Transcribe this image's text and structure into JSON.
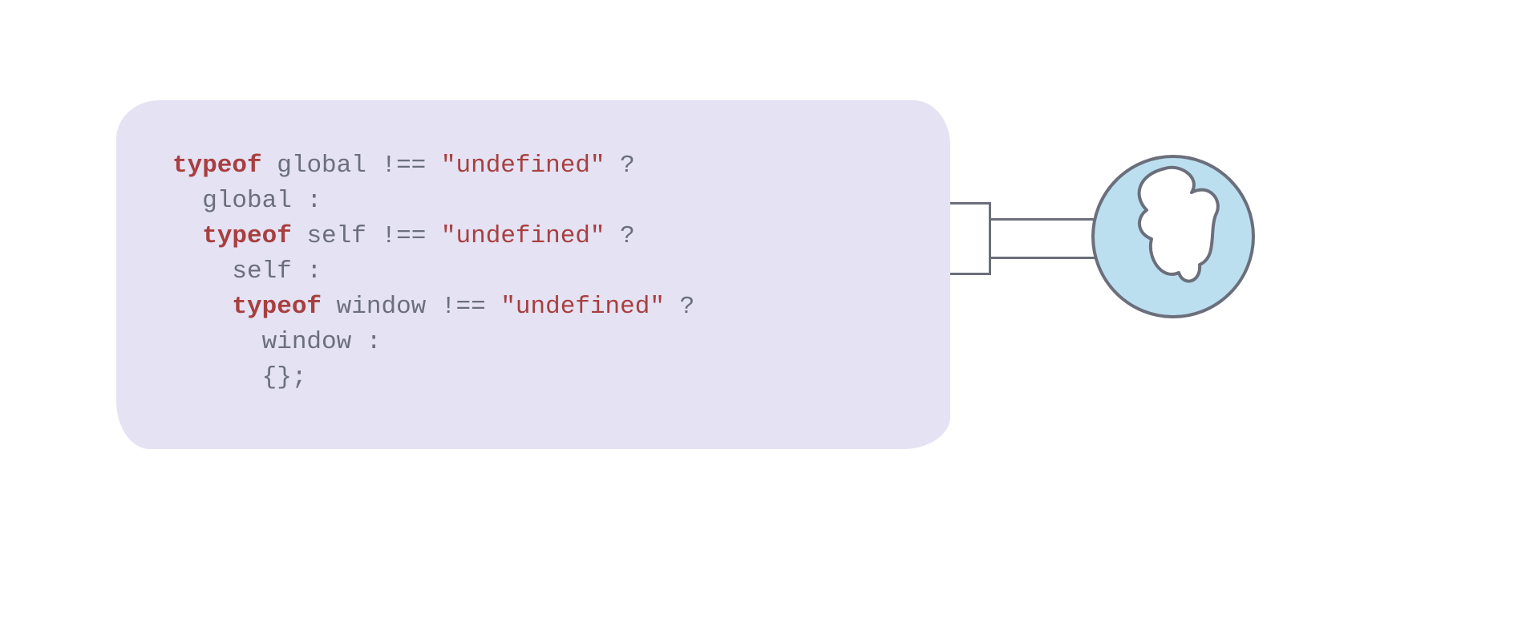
{
  "code": {
    "line1": {
      "kw": "typeof",
      "id": "global",
      "op": "!==",
      "str": "\"undefined\"",
      "tern": "?"
    },
    "line2": {
      "id": "global",
      "colon": ":"
    },
    "line3": {
      "kw": "typeof",
      "id": "self",
      "op": "!==",
      "str": "\"undefined\"",
      "tern": "?"
    },
    "line4": {
      "id": "self",
      "colon": ":"
    },
    "line5": {
      "kw": "typeof",
      "id": "window",
      "op": "!==",
      "str": "\"undefined\"",
      "tern": "?"
    },
    "line6": {
      "id": "window",
      "colon": ":"
    },
    "line7": {
      "obj": "{};"
    }
  },
  "icon": {
    "name": "globe-icon",
    "fill": "#bcdff0",
    "stroke": "#6b6f7b"
  },
  "colors": {
    "panel_bg": "#e4e2f3",
    "keyword": "#a83f3f",
    "string": "#a83f3f",
    "default": "#6b6f7b",
    "connector": "#6b6f7b"
  }
}
